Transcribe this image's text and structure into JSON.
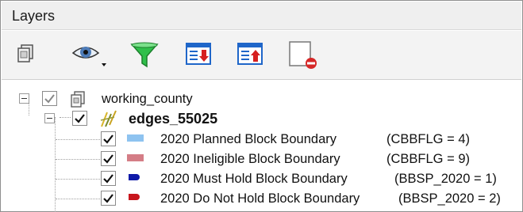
{
  "panel": {
    "title": "Layers"
  },
  "toolbar": {
    "buttons": [
      {
        "icon": "add-group-icon"
      },
      {
        "icon": "manage-visibility-icon"
      },
      {
        "icon": "filter-legend-icon"
      },
      {
        "icon": "expand-all-icon"
      },
      {
        "icon": "collapse-all-icon"
      },
      {
        "icon": "remove-layer-icon"
      }
    ]
  },
  "tree": {
    "group": {
      "label": "working_county",
      "checked": true
    },
    "layer": {
      "label": "edges_55025",
      "checked": true
    },
    "legend": [
      {
        "label": "2020 Planned Block Boundary",
        "expr": "(CBBFLG = 4)",
        "color": "#8ec3f0",
        "symbol": "rect",
        "checked": true
      },
      {
        "label": "2020 Ineligible Block Boundary",
        "expr": "(CBBFLG = 9)",
        "color": "#d47d86",
        "symbol": "rect",
        "checked": true
      },
      {
        "label": "2020 Must Hold Block Boundary",
        "expr": "(BBSP_2020 = 1)",
        "color": "#0f1aa8",
        "symbol": "pill",
        "checked": true
      },
      {
        "label": "2020 Do Not Hold Block Boundary",
        "expr": "(BBSP_2020 = 2)",
        "color": "#c8161d",
        "symbol": "pill",
        "checked": true
      }
    ]
  }
}
